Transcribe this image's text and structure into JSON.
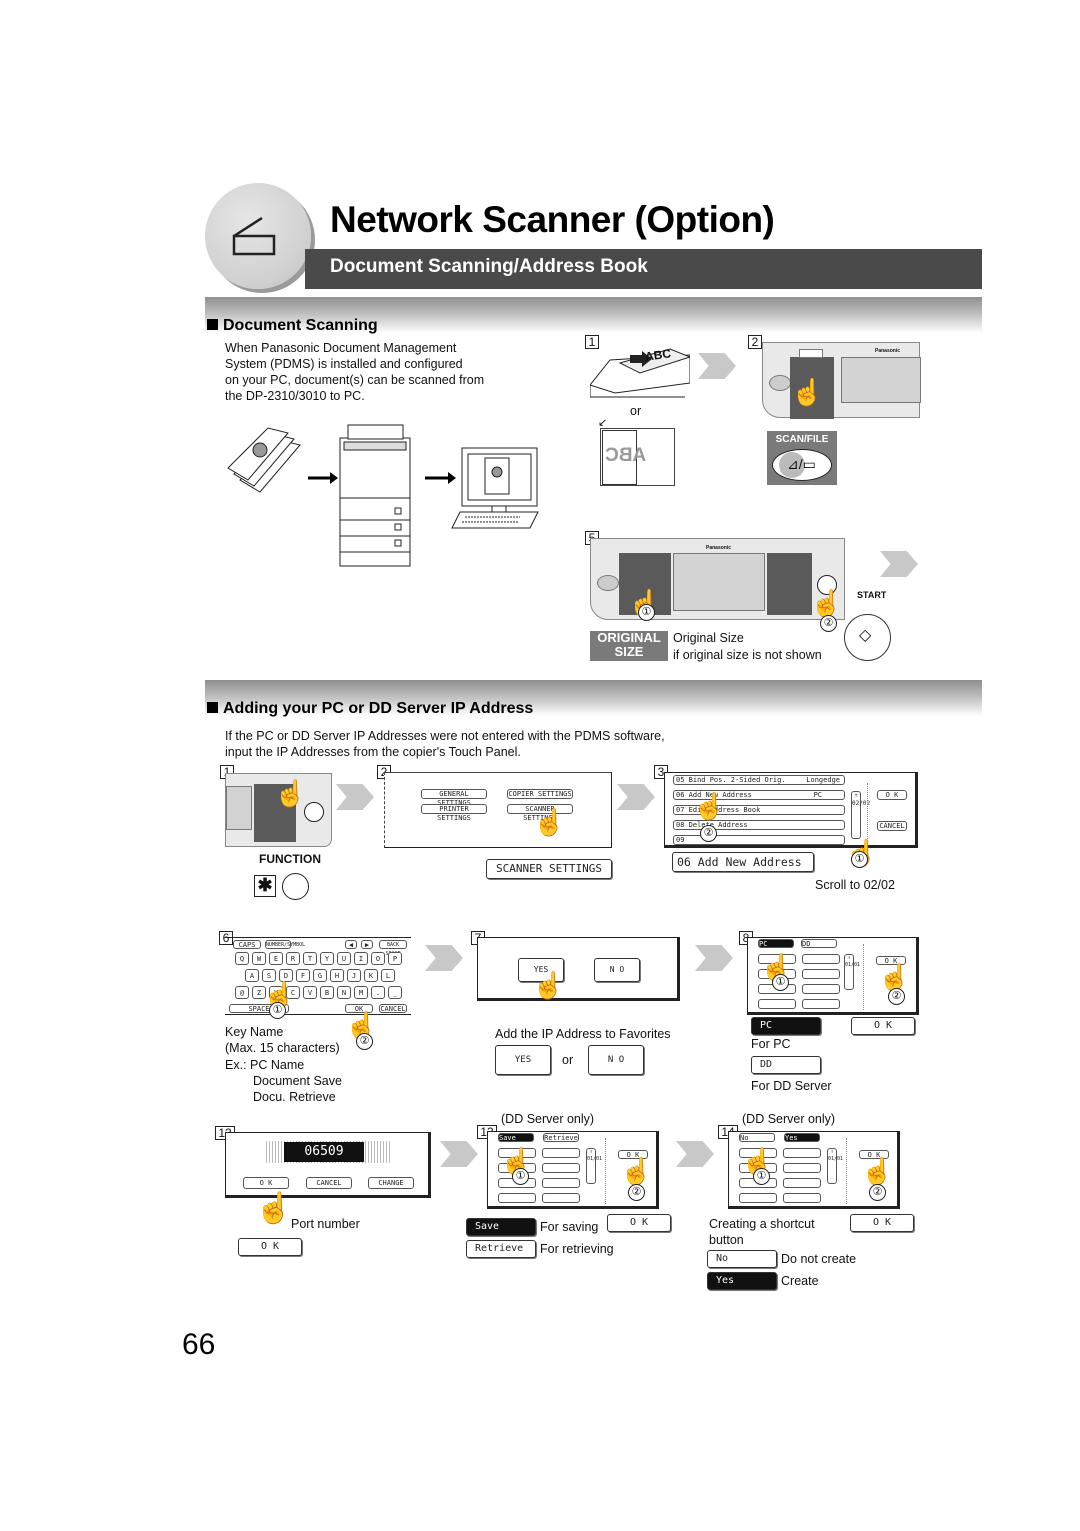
{
  "header": {
    "title": "Network Scanner (Option)",
    "subtitle": "Document Scanning/Address Book",
    "chapter_icon": "scanner-icon"
  },
  "document_scanning": {
    "title": "Document Scanning",
    "description": [
      "When Panasonic Document Management",
      "System (PDMS) is installed and configured",
      "on your PC, document(s) can be scanned from",
      "the DP-2310/3010 to PC."
    ],
    "steps": [
      {
        "num": "1",
        "adf_text": "ABC",
        "or_label": "or",
        "glass_text": "ABC"
      },
      {
        "num": "2",
        "button_label": "SCAN/FILE",
        "brand": "Panasonic"
      },
      {
        "num": "5",
        "brand": "Panasonic",
        "start_label": "START",
        "original_size_button": [
          "ORIGINAL",
          "SIZE"
        ],
        "original_size_caption": "Original Size",
        "original_size_note": "if original size is not shown",
        "markers": [
          "①",
          "②"
        ]
      }
    ]
  },
  "adding_ip": {
    "title": "Adding your PC or DD Server IP Address",
    "description": [
      "If the PC or DD Server IP Addresses were not entered with the PDMS software,",
      "input the IP Addresses from the copier's Touch Panel."
    ],
    "step1": {
      "num": "1",
      "key_label": "FUNCTION"
    },
    "step2": {
      "num": "2",
      "buttons": [
        "GENERAL SETTINGS",
        "COPIER SETTINGS",
        "PRINTER SETTINGS",
        "SCANNER SETTINGS"
      ],
      "callout": "SCANNER SETTINGS"
    },
    "step3": {
      "num": "3",
      "rows": [
        {
          "label": "05  Bind Pos. 2-Sided Orig.",
          "value": "Longedge"
        },
        {
          "label": "06  Add New Address",
          "value": "PC"
        },
        {
          "label": "07  Edit Address Book",
          "value": ""
        },
        {
          "label": "08  Delete Address",
          "value": ""
        },
        {
          "label": "09",
          "value": ""
        }
      ],
      "page_indicator": "02/02",
      "ok": "O K",
      "cancel": "CANCEL",
      "callout": "06  Add New Address",
      "caption": "Scroll to 02/02"
    },
    "step6": {
      "num": "6",
      "top_keys": [
        "CAPS",
        "NUMBER/SYMBOL",
        "◀",
        "▶",
        "BACK SPACE"
      ],
      "row1": [
        "Q",
        "W",
        "E",
        "R",
        "T",
        "Y",
        "U",
        "I",
        "O",
        "P"
      ],
      "row2": [
        "A",
        "S",
        "D",
        "F",
        "G",
        "H",
        "J",
        "K",
        "L"
      ],
      "row3": [
        "@",
        "Z",
        "X",
        "C",
        "V",
        "B",
        "N",
        "M",
        ".",
        "_"
      ],
      "bottom_keys": [
        "SPACE",
        "OK",
        "CANCEL"
      ],
      "caption": [
        "Key Name",
        "(Max. 15 characters)",
        "Ex.: PC Name",
        "Document Save",
        "Docu. Retrieve"
      ]
    },
    "step7": {
      "num": "7",
      "yes": "YES",
      "no": "N O",
      "caption": "Add the IP Address to Favorites",
      "or_label": "or"
    },
    "step8": {
      "num": "8",
      "tabs": [
        "PC",
        "DD"
      ],
      "page_indicator": "01/01",
      "ok": "O K",
      "pc_button": "PC",
      "pc_caption": "For PC",
      "dd_button": "DD",
      "dd_caption": "For DD Server"
    },
    "step12": {
      "num": "12",
      "port_value": "06509",
      "ok": "O K",
      "cancel": "CANCEL",
      "change": "CHANGE",
      "caption": "Port number"
    },
    "step13": {
      "num": "13",
      "note": "(DD Server only)",
      "tabs": [
        "Save",
        "Retrieve"
      ],
      "page_indicator": "01/01",
      "ok": "O K",
      "save_button": "Save",
      "save_caption": "For saving",
      "retrieve_button": "Retrieve",
      "retrieve_caption": "For retrieving"
    },
    "step14": {
      "num": "14",
      "note": "(DD Server only)",
      "tabs": [
        "No",
        "Yes"
      ],
      "page_indicator": "01/01",
      "ok": "O K",
      "caption": [
        "Creating a shortcut",
        "button"
      ],
      "no_button": "No",
      "no_caption": "Do not create",
      "yes_button": "Yes",
      "yes_caption": "Create"
    }
  },
  "footer": {
    "page_number": "66"
  }
}
